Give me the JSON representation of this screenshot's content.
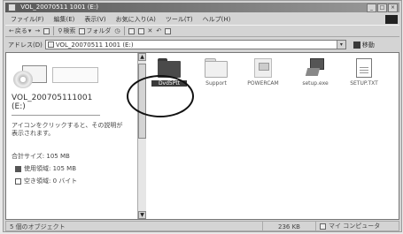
{
  "window": {
    "title": "VOL_20070511 1001 (E:)",
    "controls": [
      "_",
      "□",
      "×"
    ]
  },
  "menu": [
    "ファイル(F)",
    "編集(E)",
    "表示(V)",
    "お気に入り(A)",
    "ツール(T)",
    "ヘルプ(H)"
  ],
  "toolbar": {
    "back": "戻る",
    "search": "検索",
    "folders": "フォルダ"
  },
  "address": {
    "label": "アドレス(D)",
    "value": "VOL_20070511 1001 (E:)",
    "go": "移動"
  },
  "left_panel": {
    "drive_name_line1": "VOL_200705111001",
    "drive_name_line2": "(E:)",
    "description_line1": "アイコンをクリックすると、その説明が",
    "description_line2": "表示されます。",
    "total_size": "合計サイズ: 105 MB",
    "used": "使用領域: 105 MB",
    "free": "空き領域: 0 バイト"
  },
  "files": [
    {
      "name": "Dvd5Ptt",
      "type": "folder-selected"
    },
    {
      "name": "Support",
      "type": "folder"
    },
    {
      "name": "POWERCAM",
      "type": "pc"
    },
    {
      "name": "setup.exe",
      "type": "setup"
    },
    {
      "name": "SETUP.TXT",
      "type": "doc"
    }
  ],
  "status": {
    "objects": "5 個のオブジェクト",
    "size": "236 KB",
    "zone": "マイ コンピュータ"
  }
}
